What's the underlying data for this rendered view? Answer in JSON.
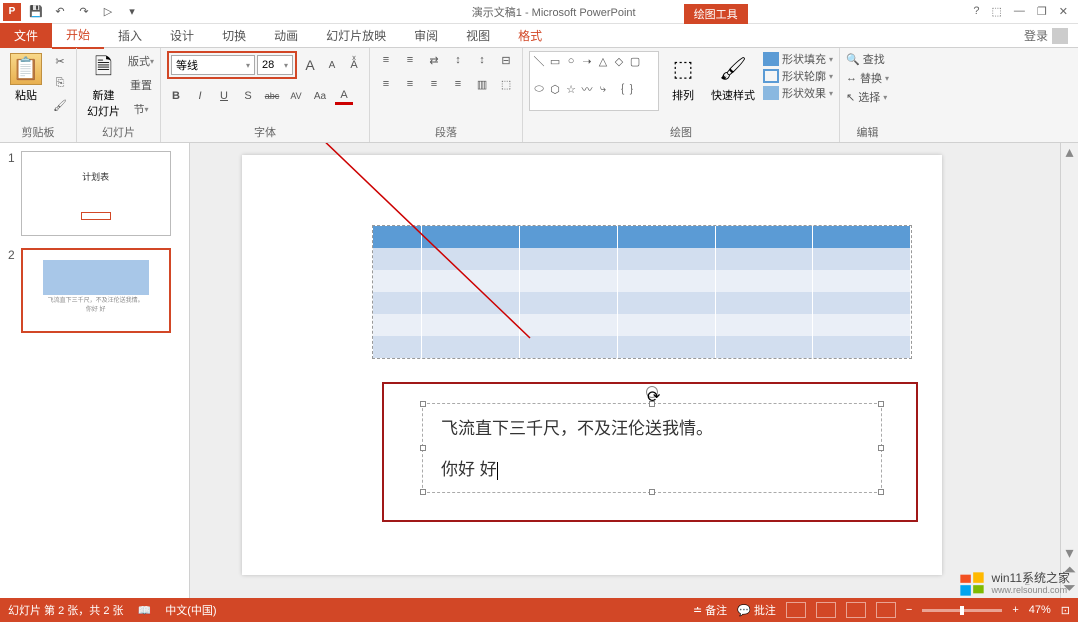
{
  "title": {
    "doc": "演示文稿1",
    "app": "Microsoft PowerPoint",
    "contextTab": "绘图工具"
  },
  "qat": {
    "save": "💾",
    "undo": "↶",
    "redo": "↷",
    "start": "▷",
    "more": "▾"
  },
  "winControls": {
    "help": "?",
    "ribbonOpts": "⬚",
    "min": "—",
    "restore": "❐",
    "close": "✕"
  },
  "tabs": {
    "file": "文件",
    "home": "开始",
    "insert": "插入",
    "design": "设计",
    "transitions": "切换",
    "animations": "动画",
    "slideshow": "幻灯片放映",
    "review": "审阅",
    "view": "视图",
    "format": "格式"
  },
  "login": "登录",
  "ribbon": {
    "clipboard": {
      "label": "剪贴板",
      "paste": "粘贴",
      "cut": "✂",
      "copy": "⎘",
      "painter": "🖌"
    },
    "slides": {
      "label": "幻灯片",
      "new": "新建\n幻灯片",
      "layout": "版式",
      "reset": "重置",
      "section": "节"
    },
    "font": {
      "label": "字体",
      "name": "等线",
      "size": "28",
      "grow": "A",
      "shrink": "A",
      "clear": "Aͯ",
      "bold": "B",
      "italic": "I",
      "underline": "U",
      "shadow": "S",
      "strike": "abc",
      "spacing": "AV",
      "case": "Aa",
      "color": "A"
    },
    "paragraph": {
      "label": "段落",
      "bullets": "≡",
      "numbering": "≡",
      "listLevel": "⇄",
      "lineSpacing": "↕",
      "direction": "↕",
      "alignText": "⊟",
      "left": "≡",
      "center": "≡",
      "right": "≡",
      "justify": "≡",
      "columns": "▥",
      "smartArt": "⬚"
    },
    "drawing": {
      "label": "绘图",
      "arrange": "排列",
      "quickStyle": "快速样式",
      "shapeFill": "形状填充",
      "shapeOutline": "形状轮廓",
      "shapeEffects": "形状效果"
    },
    "editing": {
      "label": "编辑",
      "find": "查找",
      "replace": "替换",
      "select": "选择"
    }
  },
  "thumbs": {
    "n1": "1",
    "n2": "2",
    "t1Title": "计划表",
    "t2Text1": "飞流直下三千尺，不及汪伦送我情。",
    "t2Text2": "你好 好"
  },
  "slide": {
    "text1": "飞流直下三千尺，不及汪伦送我情。",
    "text2": "你好 好"
  },
  "pageNum": "2",
  "status": {
    "slideInfo": "幻灯片 第 2 张，共 2 张",
    "lang": "中文(中国)",
    "notes": "备注",
    "comments": "批注",
    "zoom": "47%",
    "fit": "⊡"
  },
  "watermark": {
    "line1": "win11系统之家",
    "line2": "www.relsound.com"
  }
}
